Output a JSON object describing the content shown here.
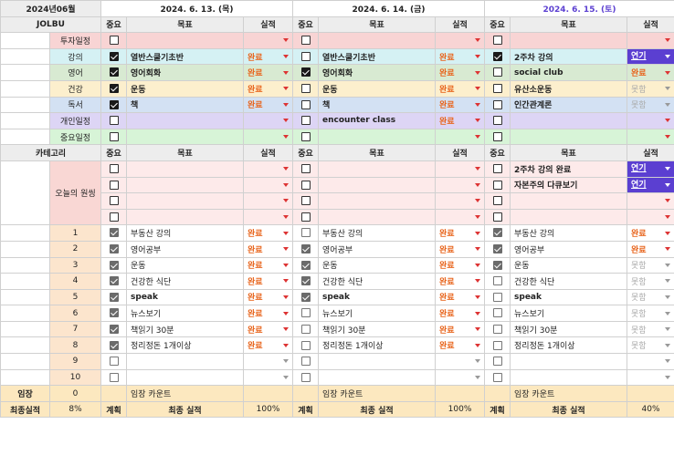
{
  "title": "2024년06월",
  "dates": [
    "2024. 6. 13. (목)",
    "2024. 6. 14. (금)",
    "2024. 6. 15. (토)"
  ],
  "jolbu": "JOLBU",
  "col_headers": {
    "importance": "중요",
    "goal": "목표",
    "result": "실적"
  },
  "status": {
    "done": "완료",
    "bad": "못함",
    "delay": "연기"
  },
  "top_sections": [
    {
      "label": "투자일정",
      "days": [
        {
          "c": false,
          "g": "",
          "s": ""
        },
        {
          "c": false,
          "g": "",
          "s": ""
        },
        {
          "c": false,
          "g": "",
          "s": ""
        }
      ]
    },
    {
      "label": "강의",
      "days": [
        {
          "c": true,
          "g": "열반스쿨기초반",
          "s": "완료"
        },
        {
          "c": false,
          "g": "열반스쿨기초반",
          "s": "완료"
        },
        {
          "c": true,
          "g": "2주차 강의",
          "s": "연기"
        }
      ]
    },
    {
      "label": "영어",
      "days": [
        {
          "c": true,
          "g": "영어회화",
          "s": "완료"
        },
        {
          "c": true,
          "g": "영어회화",
          "s": "완료"
        },
        {
          "c": false,
          "g": "social club",
          "s": "완료"
        }
      ]
    },
    {
      "label": "건강",
      "days": [
        {
          "c": true,
          "g": "운동",
          "s": "완료"
        },
        {
          "c": false,
          "g": "운동",
          "s": "완료"
        },
        {
          "c": false,
          "g": "유산소운동",
          "s": "못함"
        }
      ]
    },
    {
      "label": "독서",
      "days": [
        {
          "c": true,
          "g": "책",
          "s": "완료"
        },
        {
          "c": false,
          "g": "책",
          "s": "완료"
        },
        {
          "c": false,
          "g": "인간관계론",
          "s": "못함"
        }
      ]
    },
    {
      "label": "개인일정",
      "days": [
        {
          "c": false,
          "g": "",
          "s": ""
        },
        {
          "c": false,
          "g": "encounter class",
          "s": "완료"
        },
        {
          "c": false,
          "g": "",
          "s": ""
        }
      ]
    },
    {
      "label": "중요일정",
      "days": [
        {
          "c": false,
          "g": "",
          "s": ""
        },
        {
          "c": false,
          "g": "",
          "s": ""
        },
        {
          "c": false,
          "g": "",
          "s": ""
        }
      ]
    }
  ],
  "category_label": "카테고리",
  "one_thing_label": "오늘의 원씽",
  "one_thing_rows": [
    [
      {
        "c": false,
        "g": ""
      },
      {
        "c": false,
        "g": ""
      },
      {
        "c": false,
        "g": "2주차 강의 완료",
        "s": "연기"
      }
    ],
    [
      {
        "c": false,
        "g": ""
      },
      {
        "c": false,
        "g": ""
      },
      {
        "c": false,
        "g": "자본주의 다큐보기",
        "s": "연기"
      }
    ],
    [
      {
        "c": false,
        "g": ""
      },
      {
        "c": false,
        "g": ""
      },
      {
        "c": false,
        "g": ""
      }
    ],
    [
      {
        "c": false,
        "g": ""
      },
      {
        "c": false,
        "g": ""
      },
      {
        "c": false,
        "g": ""
      }
    ]
  ],
  "habit_rows": [
    {
      "n": "1",
      "days": [
        {
          "c": true,
          "g": "부동산 강의",
          "s": "완료"
        },
        {
          "c": false,
          "g": "부동산 강의",
          "s": "완료"
        },
        {
          "c": true,
          "g": "부동산 강의",
          "s": "완료"
        }
      ]
    },
    {
      "n": "2",
      "days": [
        {
          "c": true,
          "g": "영어공부",
          "s": "완료"
        },
        {
          "c": true,
          "g": "영어공부",
          "s": "완료"
        },
        {
          "c": true,
          "g": "영어공부",
          "s": "완료"
        }
      ]
    },
    {
      "n": "3",
      "days": [
        {
          "c": true,
          "g": "운동",
          "s": "완료"
        },
        {
          "c": true,
          "g": "운동",
          "s": "완료"
        },
        {
          "c": true,
          "g": "운동",
          "s": "못함"
        }
      ]
    },
    {
      "n": "4",
      "days": [
        {
          "c": true,
          "g": "건강한 식단",
          "s": "완료"
        },
        {
          "c": true,
          "g": "건강한 식단",
          "s": "완료"
        },
        {
          "c": false,
          "g": "건강한 식단",
          "s": "못함"
        }
      ]
    },
    {
      "n": "5",
      "days": [
        {
          "c": true,
          "g": "speak",
          "s": "완료"
        },
        {
          "c": true,
          "g": "speak",
          "s": "완료"
        },
        {
          "c": false,
          "g": "speak",
          "s": "못함"
        }
      ]
    },
    {
      "n": "6",
      "days": [
        {
          "c": true,
          "g": "뉴스보기",
          "s": "완료"
        },
        {
          "c": false,
          "g": "뉴스보기",
          "s": "완료"
        },
        {
          "c": false,
          "g": "뉴스보기",
          "s": "못함"
        }
      ]
    },
    {
      "n": "7",
      "days": [
        {
          "c": true,
          "g": "책읽기 30분",
          "s": "완료"
        },
        {
          "c": false,
          "g": "책읽기 30분",
          "s": "완료"
        },
        {
          "c": false,
          "g": "책읽기 30분",
          "s": "못함"
        }
      ]
    },
    {
      "n": "8",
      "days": [
        {
          "c": true,
          "g": "정리정돈 1개이상",
          "s": "완료"
        },
        {
          "c": false,
          "g": "정리정돈 1개이상",
          "s": "완료"
        },
        {
          "c": false,
          "g": "정리정돈 1개이상",
          "s": "못함"
        }
      ]
    },
    {
      "n": "9",
      "days": [
        {
          "c": false,
          "g": "",
          "s": ""
        },
        {
          "c": false,
          "g": "",
          "s": ""
        },
        {
          "c": false,
          "g": "",
          "s": ""
        }
      ]
    },
    {
      "n": "10",
      "days": [
        {
          "c": false,
          "g": "",
          "s": ""
        },
        {
          "c": false,
          "g": "",
          "s": ""
        },
        {
          "c": false,
          "g": "",
          "s": ""
        }
      ]
    }
  ],
  "footer": {
    "imjang_label": "임장",
    "imjang_value": "0",
    "imjang_count": "임장 카운트",
    "final_label": "최종실적",
    "final_value": "8%",
    "plan": "계획",
    "final_result": "최종 실적",
    "day_results": [
      "100%",
      "100%",
      "40%"
    ]
  },
  "colors": {
    "done": "#e8651d",
    "delay_bg": "#5b3fd1",
    "bad": "#aaaaaa",
    "day3_date": "#5b3fd1"
  }
}
